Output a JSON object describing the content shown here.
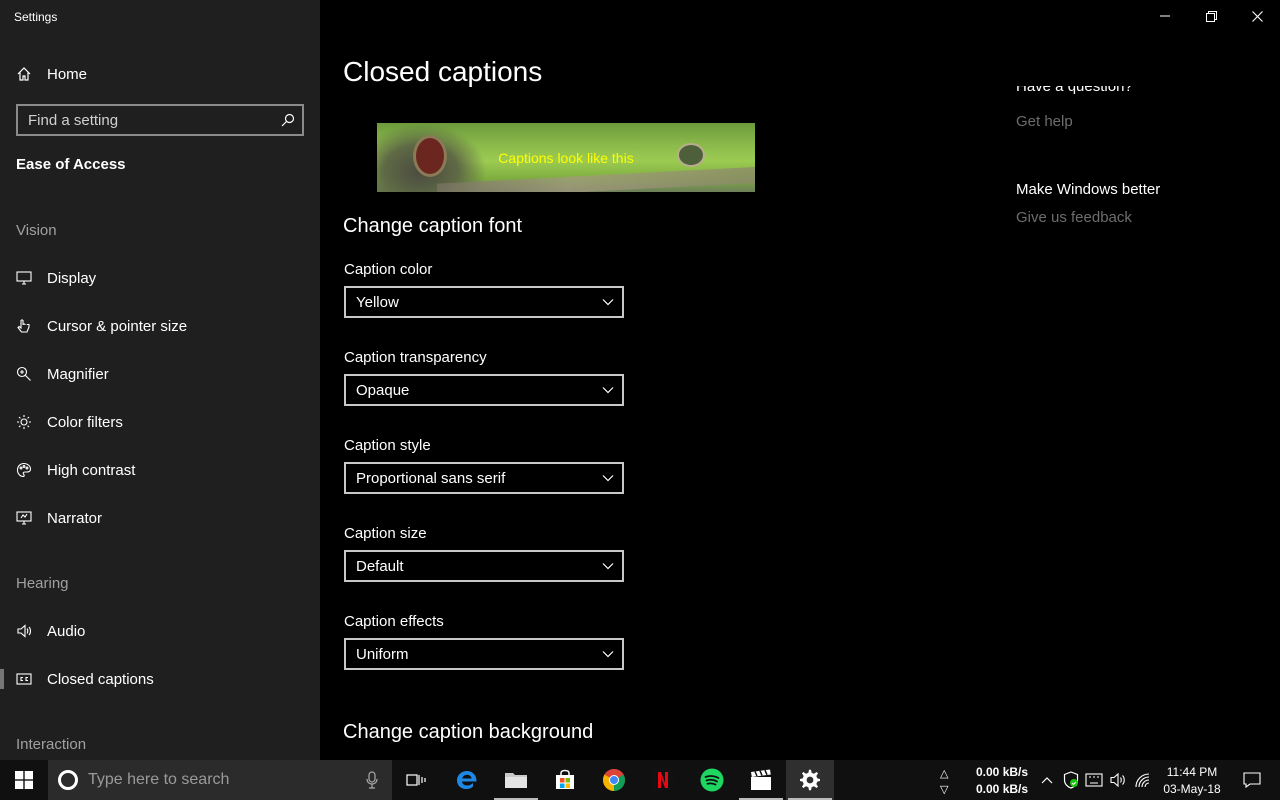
{
  "window": {
    "title": "Settings"
  },
  "sidebar": {
    "home_label": "Home",
    "search_placeholder": "Find a setting",
    "section_title": "Ease of Access",
    "groups": {
      "vision": "Vision",
      "hearing": "Hearing",
      "interaction": "Interaction"
    },
    "items": [
      {
        "label": "Display",
        "icon": "display-icon"
      },
      {
        "label": "Cursor & pointer size",
        "icon": "cursor-icon"
      },
      {
        "label": "Magnifier",
        "icon": "magnifier-icon"
      },
      {
        "label": "Color filters",
        "icon": "color-filters-icon"
      },
      {
        "label": "High contrast",
        "icon": "high-contrast-icon"
      },
      {
        "label": "Narrator",
        "icon": "narrator-icon"
      },
      {
        "label": "Audio",
        "icon": "audio-icon"
      },
      {
        "label": "Closed captions",
        "icon": "closed-captions-icon",
        "selected": true
      }
    ]
  },
  "main": {
    "title": "Closed captions",
    "preview_caption": "Captions look like this",
    "caption_color_hex": "#ffff00",
    "font_section_title": "Change caption font",
    "fields": [
      {
        "label": "Caption color",
        "value": "Yellow"
      },
      {
        "label": "Caption transparency",
        "value": "Opaque"
      },
      {
        "label": "Caption style",
        "value": "Proportional sans serif"
      },
      {
        "label": "Caption size",
        "value": "Default"
      },
      {
        "label": "Caption effects",
        "value": "Uniform"
      }
    ],
    "background_section_title": "Change caption background"
  },
  "right": {
    "question_heading": "Have a question?",
    "get_help": "Get help",
    "improve_heading": "Make Windows better",
    "feedback": "Give us feedback"
  },
  "taskbar": {
    "search_placeholder": "Type here to search",
    "upload_speed": "0.00 kB/s",
    "download_speed": "0.00 kB/s",
    "time": "11:44 PM",
    "date": "03-May-18"
  }
}
